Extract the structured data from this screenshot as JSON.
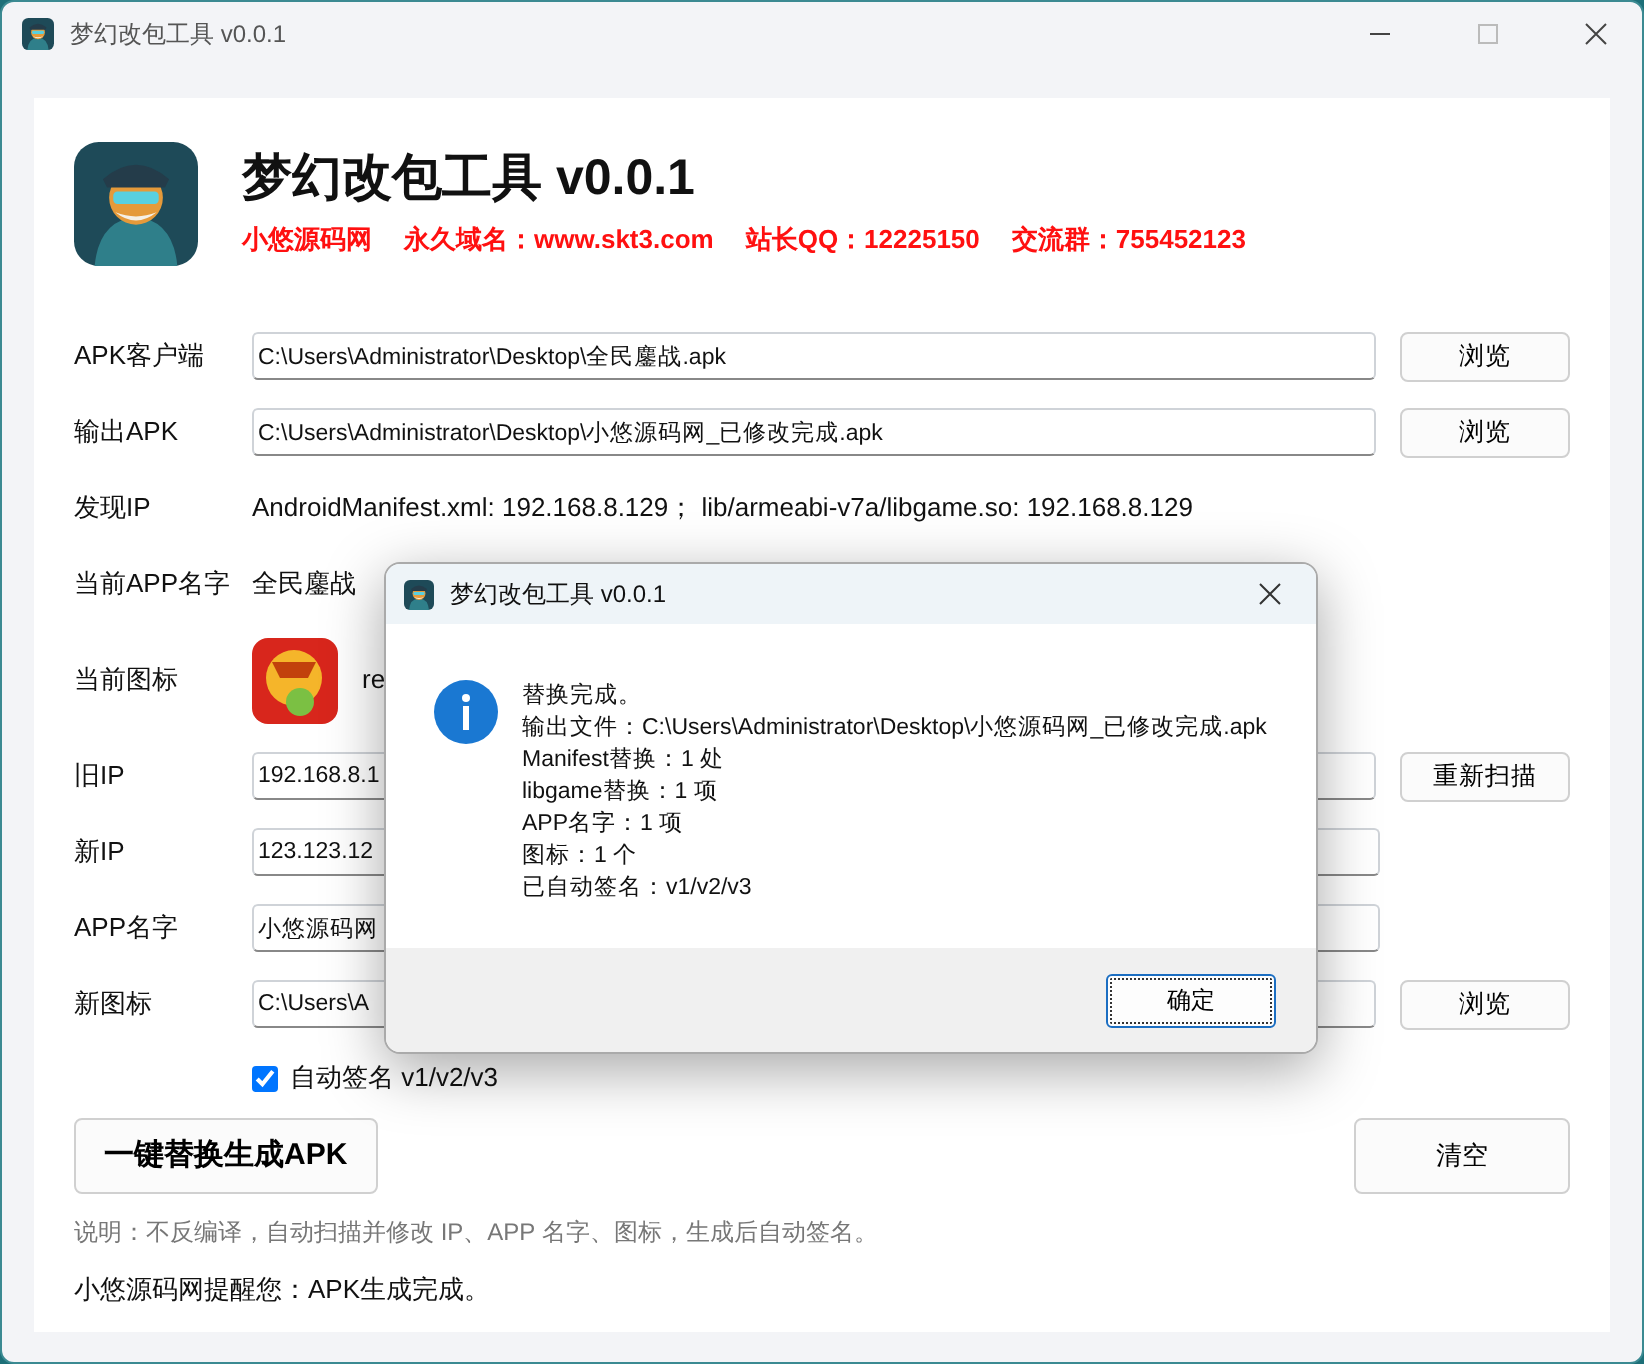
{
  "window": {
    "title": "梦幻改包工具 v0.0.1"
  },
  "header": {
    "title": "梦幻改包工具 v0.0.1",
    "info": [
      "小悠源码网",
      "永久域名：www.skt3.com",
      "站长QQ：12225150",
      "交流群：755452123"
    ]
  },
  "form": {
    "rows": [
      {
        "kind": "field",
        "label": "APK客户端",
        "value": "C:\\Users\\Administrator\\Desktop\\全民鏖战.apk",
        "button": "浏览"
      },
      {
        "kind": "field",
        "label": "输出APK",
        "value": "C:\\Users\\Administrator\\Desktop\\小悠源码网_已修改完成.apk",
        "button": "浏览"
      },
      {
        "kind": "text",
        "label": "发现IP",
        "value": "AndroidManifest.xml: 192.168.8.129；  lib/armeabi-v7a/libgame.so: 192.168.8.129"
      },
      {
        "kind": "text",
        "label": "当前APP名字",
        "value": "全民鏖战"
      },
      {
        "kind": "icon",
        "label": "当前图标",
        "value": "re"
      },
      {
        "kind": "field",
        "label": "旧IP",
        "value": "192.168.8.1",
        "button": "重新扫描"
      },
      {
        "kind": "field",
        "label": "新IP",
        "value": "123.123.12"
      },
      {
        "kind": "field",
        "label": "APP名字",
        "value": "小悠源码网"
      },
      {
        "kind": "field",
        "label": "新图标",
        "value": "C:\\Users\\A",
        "button": "浏览"
      }
    ]
  },
  "checkbox": {
    "label": "自动签名 v1/v2/v3",
    "checked": true
  },
  "actions": {
    "generate": "一键替换生成APK",
    "clear": "清空"
  },
  "note": "说明：不反编译，自动扫描并修改 IP、APP 名字、图标，生成后自动签名。",
  "status": "小悠源码网提醒您：APK生成完成。",
  "dialog": {
    "title": "梦幻改包工具 v0.0.1",
    "lines": [
      "替换完成。",
      "输出文件：C:\\Users\\Administrator\\Desktop\\小悠源码网_已修改完成.apk",
      "Manifest替换：1 处",
      "libgame替换：1 项",
      "APP名字：1 项",
      "图标：1 个",
      "已自动签名：v1/v2/v3"
    ],
    "button": "确定"
  }
}
